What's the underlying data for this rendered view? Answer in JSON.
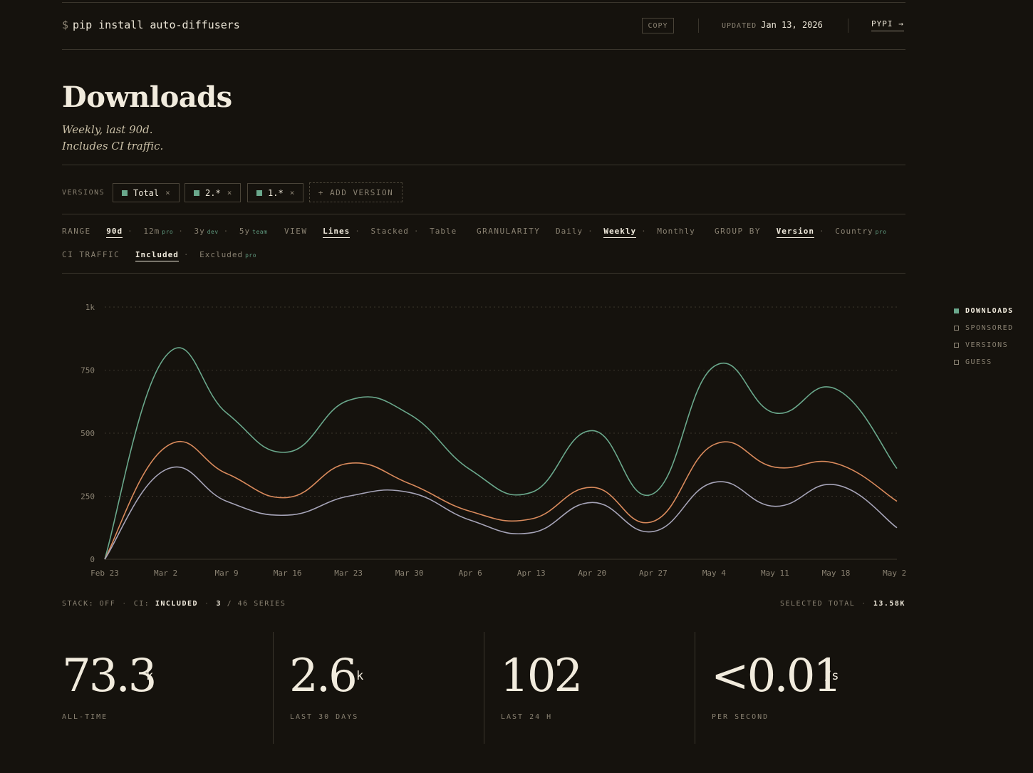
{
  "header": {
    "prompt": "$",
    "command": "pip install auto-diffusers",
    "copy_label": "COPY",
    "updated_label": "UPDATED",
    "updated_date": "Jan 13, 2026",
    "pypi_label": "PYPI →"
  },
  "page": {
    "title": "Downloads",
    "subtitle_1": "Weekly, last 90d.",
    "subtitle_2": "Includes CI traffic."
  },
  "versions": {
    "label": "VERSIONS",
    "chips": [
      {
        "label": "Total",
        "close": "×"
      },
      {
        "label": "2.*",
        "close": "×"
      },
      {
        "label": "1.*",
        "close": "×"
      }
    ],
    "add_label": "+ ADD VERSION"
  },
  "controls": {
    "range": {
      "label": "RANGE",
      "opt1": "90d",
      "opt2": "12m",
      "opt2_tag": "pro",
      "opt3": "3y",
      "opt3_tag": "dev",
      "opt4": "5y",
      "opt4_tag": "team"
    },
    "view": {
      "label": "VIEW",
      "opt1": "Lines",
      "opt2": "Stacked",
      "opt3": "Table"
    },
    "granularity": {
      "label": "GRANULARITY",
      "opt1": "Daily",
      "opt2": "Weekly",
      "opt3": "Monthly"
    },
    "group_by": {
      "label": "GROUP BY",
      "opt1": "Version",
      "opt2": "Country",
      "opt2_tag": "pro"
    },
    "ci": {
      "label": "CI TRAFFIC",
      "opt1": "Included",
      "opt2": "Excluded",
      "opt2_tag": "pro"
    },
    "sep": "·"
  },
  "legend": {
    "items": [
      "DOWNLOADS",
      "SPONSORED",
      "VERSIONS",
      "GUESS"
    ],
    "active_color": "#6aa88c"
  },
  "chart_data": {
    "type": "line",
    "x": [
      "Feb 23",
      "Mar 2",
      "Mar 9",
      "Mar 16",
      "Mar 23",
      "Mar 30",
      "Apr 6",
      "Apr 13",
      "Apr 20",
      "Apr 27",
      "May 4",
      "May 11",
      "May 18",
      "May 25"
    ],
    "yticks": [
      0,
      250,
      500,
      750,
      1000
    ],
    "ytick_labels": [
      "0",
      "250",
      "500",
      "750",
      "1k"
    ],
    "ylim": [
      0,
      1000
    ],
    "grid": true,
    "series": [
      {
        "color": "#6aa88c",
        "values": [
          0,
          805,
          580,
          425,
          630,
          575,
          355,
          265,
          510,
          260,
          765,
          580,
          675,
          360
        ]
      },
      {
        "color": "#d98a5c",
        "values": [
          0,
          445,
          340,
          245,
          380,
          300,
          190,
          160,
          285,
          150,
          455,
          365,
          380,
          230
        ]
      },
      {
        "color": "#a6a4b8",
        "values": [
          0,
          355,
          230,
          175,
          250,
          265,
          155,
          105,
          225,
          110,
          305,
          210,
          295,
          125
        ]
      }
    ]
  },
  "footer": {
    "stack_label": "STACK:",
    "stack_value": "OFF",
    "ci_label": "CI:",
    "ci_value": "INCLUDED",
    "series_shown": "3",
    "series_total": "/ 46 SERIES",
    "sep": "·",
    "selected_label": "SELECTED TOTAL",
    "selected_value": "13.58K"
  },
  "stats": [
    {
      "value": "73.3",
      "unit": "k",
      "label": "ALL-TIME"
    },
    {
      "value": "2.6",
      "unit": "k",
      "label": "LAST 30 DAYS"
    },
    {
      "value": "102",
      "unit": "",
      "label": "LAST 24 H"
    },
    {
      "value": "<0.01",
      "unit": "/s",
      "label": "PER SECOND"
    }
  ]
}
